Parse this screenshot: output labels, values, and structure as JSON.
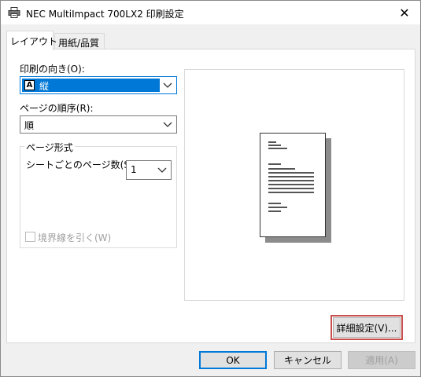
{
  "window": {
    "title": "NEC MultiImpact 700LX2 印刷設定",
    "close_glyph": "✕"
  },
  "tabs": [
    {
      "label": "レイアウト",
      "active": true
    },
    {
      "label": "用紙/品質",
      "active": false
    }
  ],
  "layout": {
    "orientation_label": "印刷の向き(O):",
    "orientation_value": "縦",
    "orientation_glyph": "A",
    "page_order_label": "ページの順序(R):",
    "page_order_value": "順",
    "page_format_legend": "ページ形式",
    "pages_per_sheet_label": "シートごとのページ数(S)",
    "pages_per_sheet_value": "1",
    "border_checkbox_label": "境界線を引く(W)",
    "border_checked": false
  },
  "buttons": {
    "advanced": "詳細設定(V)...",
    "ok": "OK",
    "cancel": "キャンセル",
    "apply": "適用(A)"
  },
  "icons": {
    "title": "printer-icon",
    "dropdown": "chevron-down-icon",
    "close": "close-icon"
  },
  "colors": {
    "accent": "#0078d7",
    "highlight": "#c8504f"
  }
}
